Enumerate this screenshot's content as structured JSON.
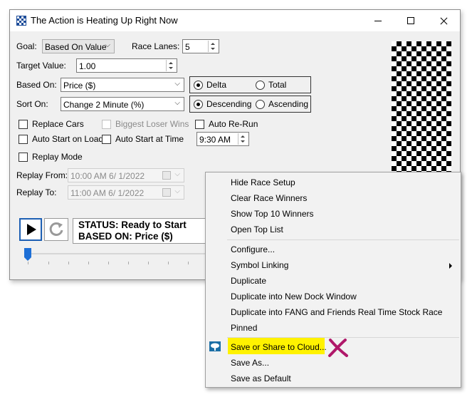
{
  "window": {
    "title": "The Action is Heating Up Right Now"
  },
  "form": {
    "goal_label": "Goal:",
    "goal_value": "Based On Value",
    "race_lanes_label": "Race Lanes:",
    "race_lanes_value": "5",
    "target_value_label": "Target Value:",
    "target_value": "1.00",
    "based_on_label": "Based On:",
    "based_on_value": "Price ($)",
    "sort_on_label": "Sort On:",
    "sort_on_value": "Change 2 Minute (%)",
    "radio_delta": "Delta",
    "radio_total": "Total",
    "radio_descending": "Descending",
    "radio_ascending": "Ascending",
    "replace_cars": "Replace Cars",
    "biggest_loser_wins": "Biggest Loser Wins",
    "auto_rerun": "Auto Re-Run",
    "auto_start_on_load": "Auto Start on Load",
    "auto_start_at_time": "Auto Start at Time",
    "auto_start_time_value": "9:30 AM",
    "replay_mode": "Replay Mode",
    "replay_from_label": "Replay From:",
    "replay_from_value": "10:00 AM  6/  1/2022",
    "replay_to_label": "Replay To:",
    "replay_to_value": "11:00 AM  6/  1/2022"
  },
  "status": {
    "status_line": "STATUS: Ready to Start",
    "based_on_line": "BASED ON: Price ($)"
  },
  "context_menu": {
    "items": [
      "Hide Race Setup",
      "Clear Race Winners",
      "Show Top 10 Winners",
      "Open Top List",
      "Configure...",
      "Symbol Linking",
      "Duplicate",
      "Duplicate into New Dock Window",
      "Duplicate into FANG and Friends Real Time Stock Race",
      "Pinned",
      "Save or Share to Cloud...",
      "Save As...",
      "Save as Default"
    ],
    "highlight_color": "#fff200",
    "annotation_color": "#b0186a"
  }
}
